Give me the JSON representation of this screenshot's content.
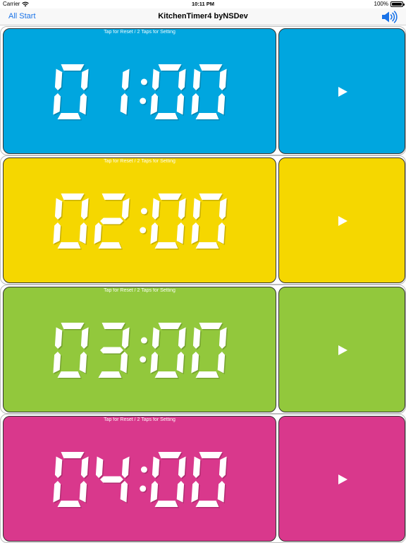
{
  "status_bar": {
    "carrier": "Carrier",
    "time": "10:11 PM",
    "battery": "100%"
  },
  "nav": {
    "left_button": "All Start",
    "title": "KitchenTimer4 byNSDev",
    "right_icon": "speaker-volume-icon",
    "accent_color": "#1a73e8"
  },
  "timers": [
    {
      "hint": "Tap for Reset / 2 Taps for Setting",
      "time": "01:00",
      "color": "#00a6df",
      "play_icon": "play-icon"
    },
    {
      "hint": "Tap for Reset / 2 Taps for Setting",
      "time": "02:00",
      "color": "#f5d700",
      "play_icon": "play-icon"
    },
    {
      "hint": "Tap for Reset / 2 Taps for Setting",
      "time": "03:00",
      "color": "#92c83c",
      "play_icon": "play-icon"
    },
    {
      "hint": "Tap for Reset / 2 Taps for Setting",
      "time": "04:00",
      "color": "#d9388c",
      "play_icon": "play-icon"
    }
  ]
}
